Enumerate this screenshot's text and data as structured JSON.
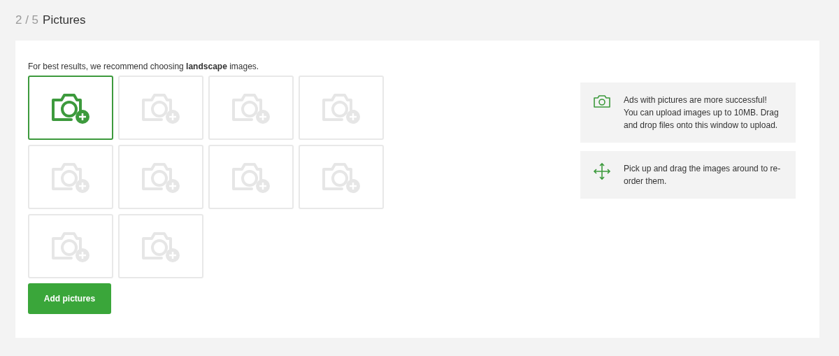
{
  "header": {
    "step": "2 / 5",
    "title": "Pictures"
  },
  "hint": "For best results, we recommend choosing **landscape** images.",
  "slots": [
    {
      "active": true
    },
    {
      "active": false
    },
    {
      "active": false
    },
    {
      "active": false
    },
    {
      "active": false
    },
    {
      "active": false
    },
    {
      "active": false
    },
    {
      "active": false
    },
    {
      "active": false
    },
    {
      "active": false
    }
  ],
  "add_button": "Add pictures",
  "tips": [
    {
      "kind": "camera",
      "text": "Ads with pictures are more successful! You can upload images up to 10MB. Drag and drop files onto this window to upload."
    },
    {
      "kind": "move",
      "text": "Pick up and drag the images around to re-order them."
    }
  ]
}
